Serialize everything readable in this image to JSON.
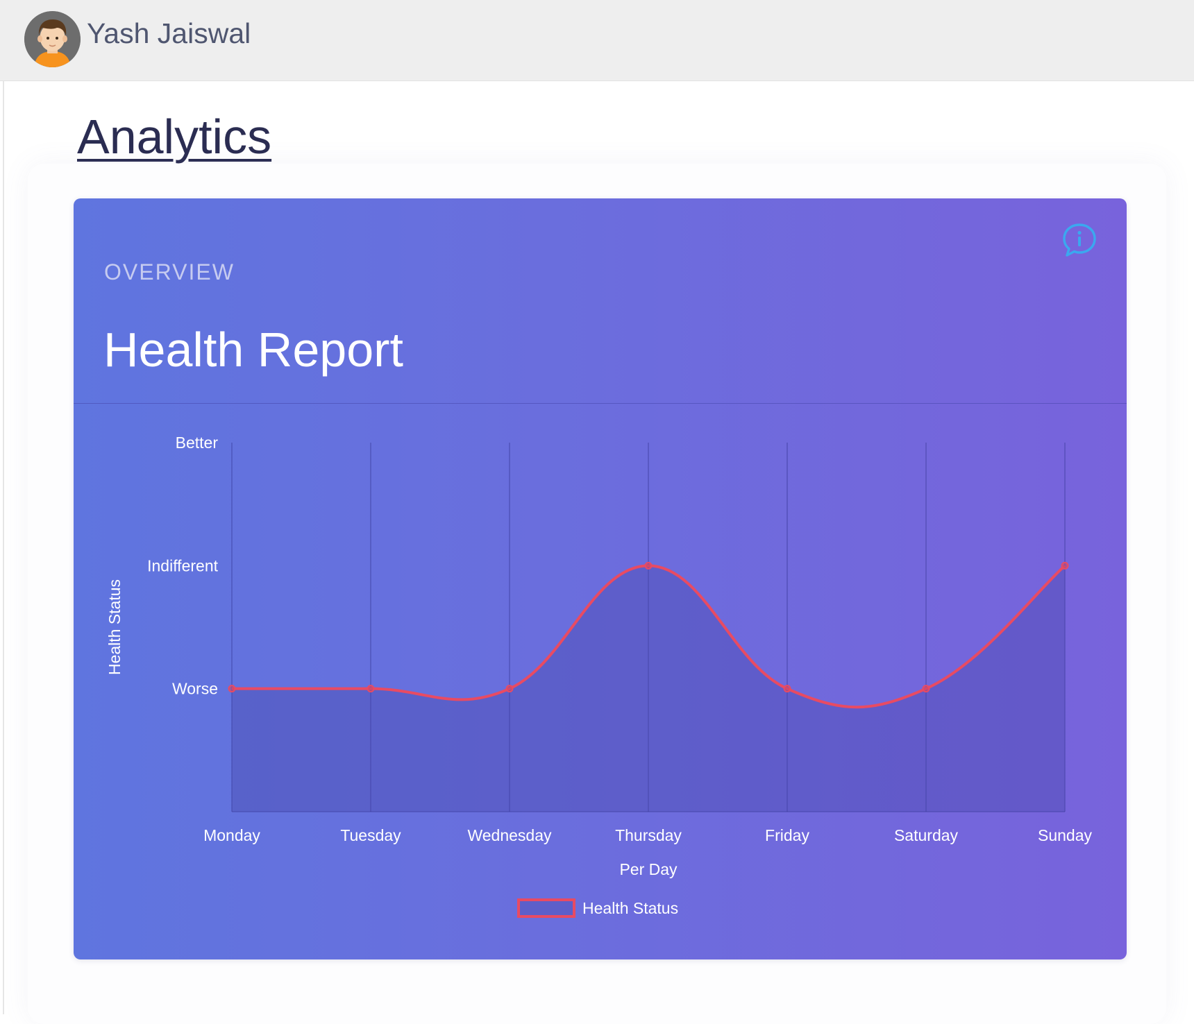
{
  "user": {
    "name": "Yash Jaiswal",
    "avatar_icon": "user-avatar-icon"
  },
  "page": {
    "title": "Analytics"
  },
  "card": {
    "eyebrow": "OVERVIEW",
    "title": "Health Report",
    "info_icon": "info-chat-icon"
  },
  "colors": {
    "line": "#e84b63",
    "card_start": "#5f75df",
    "card_end": "#7863dc",
    "info": "#3ba8ef"
  },
  "chart_data": {
    "type": "area",
    "categories": [
      "Monday",
      "Tuesday",
      "Wednesday",
      "Thursday",
      "Friday",
      "Saturday",
      "Sunday"
    ],
    "y_levels": [
      "Worse",
      "Indifferent",
      "Better"
    ],
    "series": [
      {
        "name": "Health Status",
        "values": [
          1,
          1,
          1,
          2,
          1,
          1,
          2
        ]
      }
    ],
    "ylim": [
      0,
      3
    ],
    "xlabel": "Per Day",
    "ylabel": "Health Status",
    "grid": "vertical",
    "legend": "bottom-center"
  }
}
